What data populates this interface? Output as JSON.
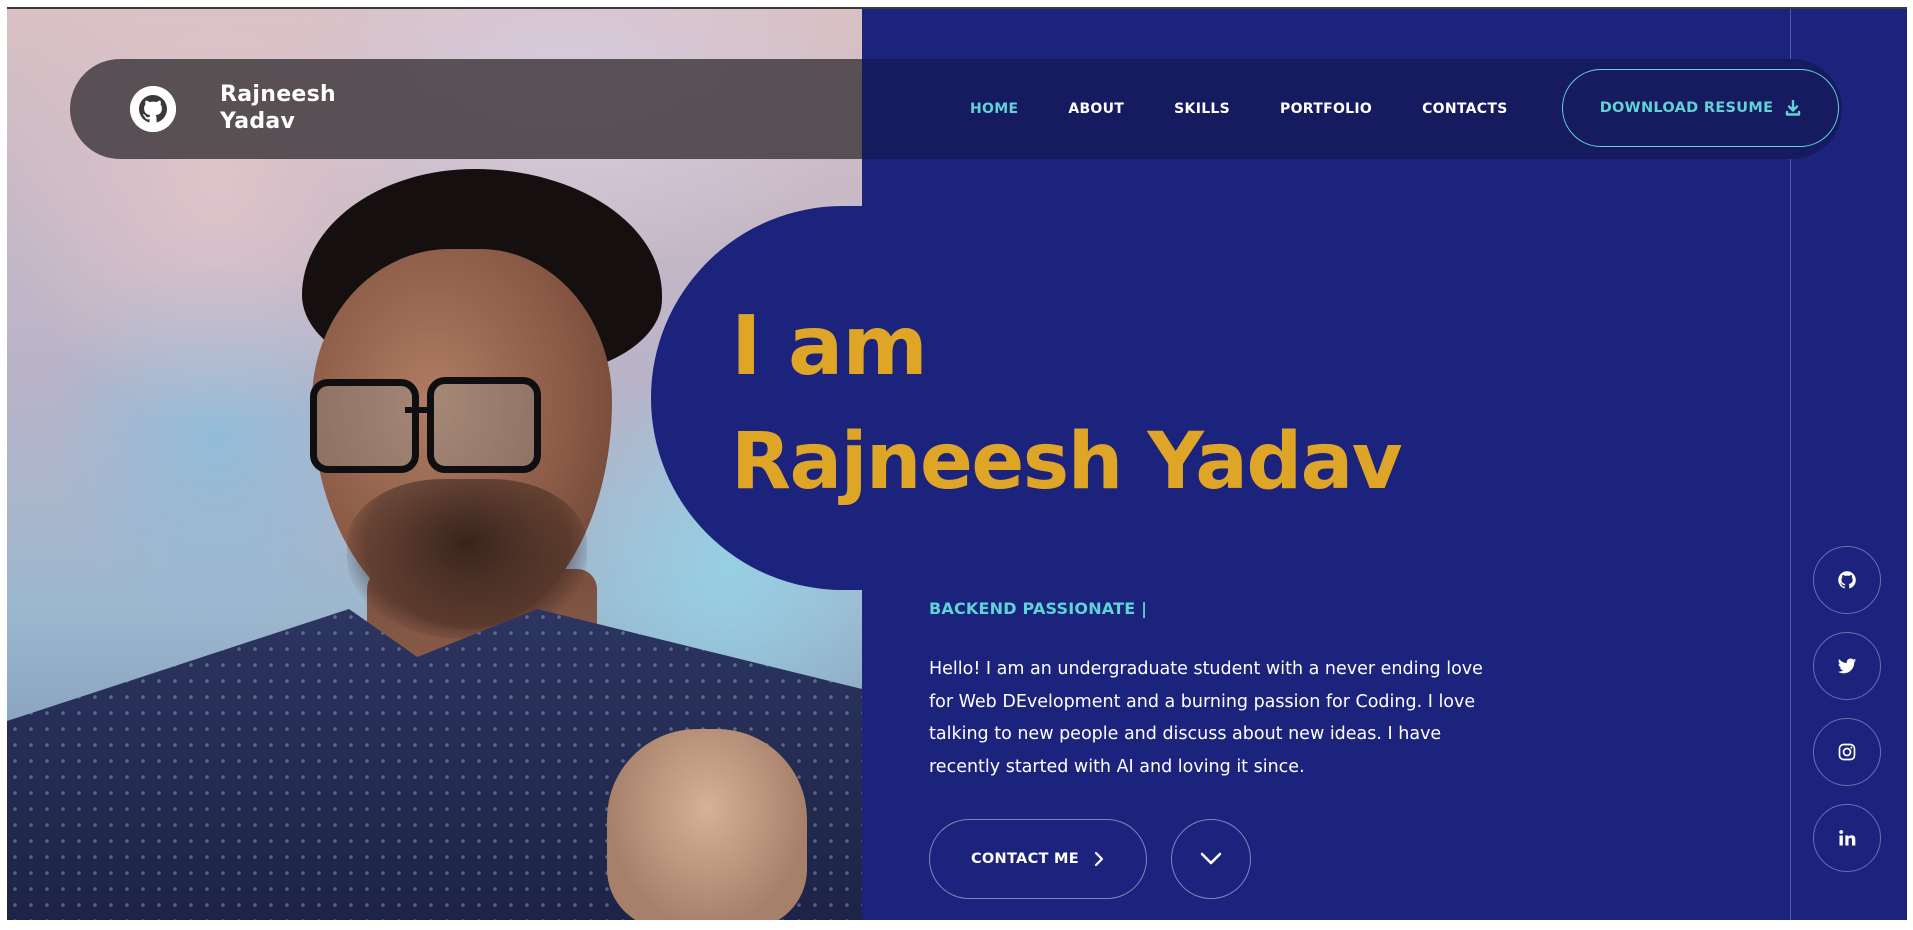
{
  "brand": {
    "name_line1": "Rajneesh",
    "name_line2": "Yadav",
    "logo_icon": "github-icon"
  },
  "nav": {
    "items": [
      {
        "label": "HOME",
        "active": true
      },
      {
        "label": "ABOUT",
        "active": false
      },
      {
        "label": "SKILLS",
        "active": false
      },
      {
        "label": "PORTFOLIO",
        "active": false
      },
      {
        "label": "CONTACTS",
        "active": false
      }
    ],
    "resume_label": "DOWNLOAD RESUME",
    "resume_icon": "download-icon"
  },
  "hero": {
    "line1": "I am",
    "line2": "Rajneesh Yadav",
    "tagline": "BACKEND PASSIONATE |",
    "bio": "Hello! I am an undergraduate student with a never ending love for Web DEvelopment and a burning passion for Coding. I love talking to new people and discuss about new ideas. I have recently started with AI and loving it since.",
    "contact_label": "CONTACT ME",
    "scroll_icon": "chevron-down-icon"
  },
  "photo": {
    "subject": "portrait-photo"
  },
  "social": [
    {
      "icon": "github-icon"
    },
    {
      "icon": "twitter-icon"
    },
    {
      "icon": "instagram-icon"
    },
    {
      "icon": "linkedin-icon"
    }
  ],
  "colors": {
    "background": "#1b237d",
    "header_dark": "#151b5e",
    "accent_teal": "#5fd3d8",
    "accent_gold": "#dfa526",
    "text": "#ffffff"
  }
}
